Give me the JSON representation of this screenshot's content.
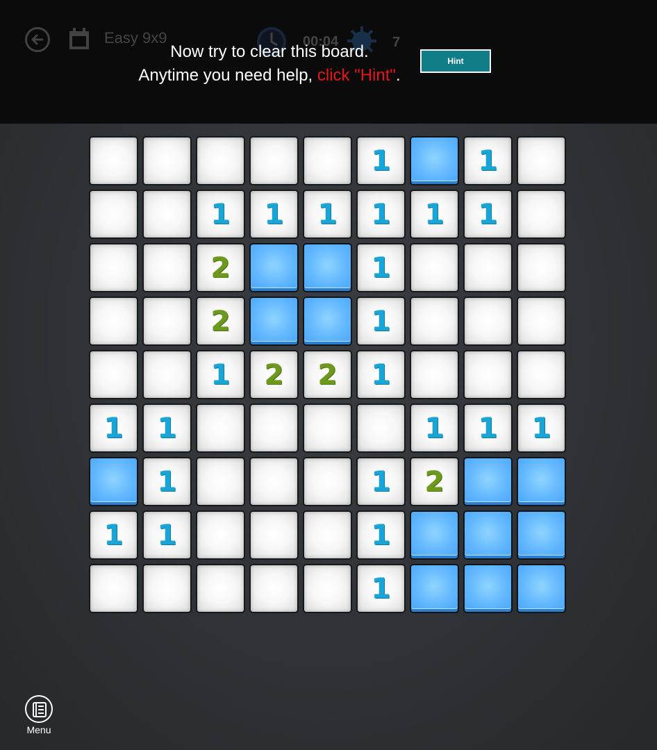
{
  "header": {
    "mode_label": "Easy 9x9",
    "timer": "00:04",
    "mine_count": "7",
    "icons": [
      "back-arrow-icon",
      "calendar-icon",
      "clock-icon",
      "mine-icon"
    ]
  },
  "tutorial": {
    "line1": "Now try to clear this board.",
    "line2_prefix": "Anytime you need help, ",
    "line2_highlight": "click \"Hint\"",
    "line2_suffix": ".",
    "highlight_color": "#e8151b"
  },
  "hint_button": {
    "label": "Hint",
    "color": "#117d88"
  },
  "board": {
    "rows": 9,
    "cols": 9,
    "legend": {
      "C": "covered",
      "0": "revealed-empty",
      "1": "one",
      "2": "two"
    },
    "grid": [
      [
        "0",
        "0",
        "0",
        "0",
        "0",
        "1",
        "C",
        "1",
        "0"
      ],
      [
        "0",
        "0",
        "1",
        "1",
        "1",
        "1",
        "1",
        "1",
        "0"
      ],
      [
        "0",
        "0",
        "2",
        "C",
        "C",
        "1",
        "0",
        "0",
        "0"
      ],
      [
        "0",
        "0",
        "2",
        "C",
        "C",
        "1",
        "0",
        "0",
        "0"
      ],
      [
        "0",
        "0",
        "1",
        "2",
        "2",
        "1",
        "0",
        "0",
        "0"
      ],
      [
        "1",
        "1",
        "0",
        "0",
        "0",
        "0",
        "1",
        "1",
        "1"
      ],
      [
        "C",
        "1",
        "0",
        "0",
        "0",
        "1",
        "2",
        "C",
        "C"
      ],
      [
        "1",
        "1",
        "0",
        "0",
        "0",
        "1",
        "C",
        "C",
        "C"
      ],
      [
        "0",
        "0",
        "0",
        "0",
        "0",
        "1",
        "C",
        "C",
        "C"
      ]
    ]
  },
  "menu": {
    "label": "Menu"
  },
  "colors": {
    "covered_tile": "#62b7ff",
    "number_one": "#19a6d6",
    "number_two": "#6d9a1c",
    "background": "#2f3236"
  }
}
